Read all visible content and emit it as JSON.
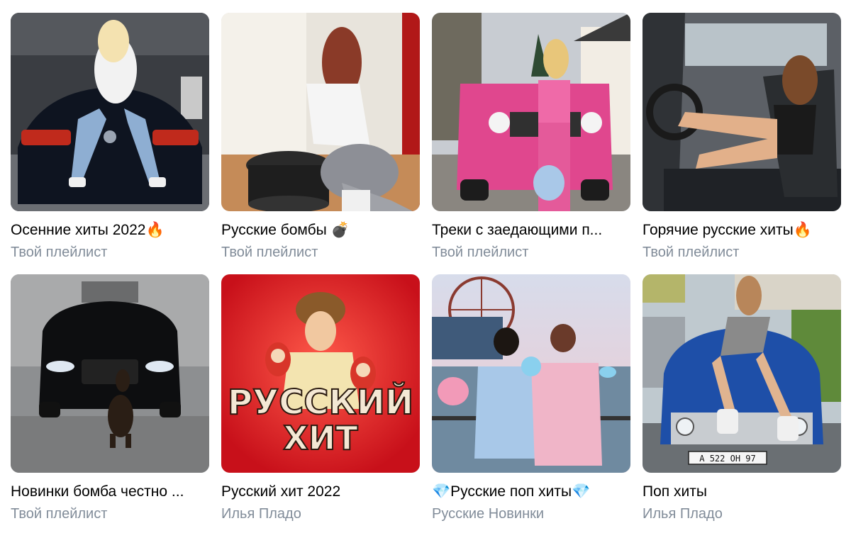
{
  "playlists": [
    {
      "title": "Осенние хиты 2022🔥",
      "subtitle": "Твой плейлист"
    },
    {
      "title": "Русские бомбы 💣",
      "subtitle": "Твой плейлист"
    },
    {
      "title": "Треки с заедающими п...",
      "subtitle": "Твой плейлист"
    },
    {
      "title": "Горячие русские хиты🔥",
      "subtitle": "Твой плейлист"
    },
    {
      "title": "Новинки бомба честно ...",
      "subtitle": "Твой плейлист"
    },
    {
      "title": "Русский хит 2022",
      "subtitle": "Илья Пладо"
    },
    {
      "title": "💎Русские поп хиты💎",
      "subtitle": "Русские Новинки"
    },
    {
      "title": "Поп хиты",
      "subtitle": "Илья Пладо"
    }
  ],
  "cover_art": {
    "russkiy_hit_line1": "РУССКИЙ",
    "russkiy_hit_line2": "ХИТ",
    "license_plate": "А 522 ОН 97"
  }
}
